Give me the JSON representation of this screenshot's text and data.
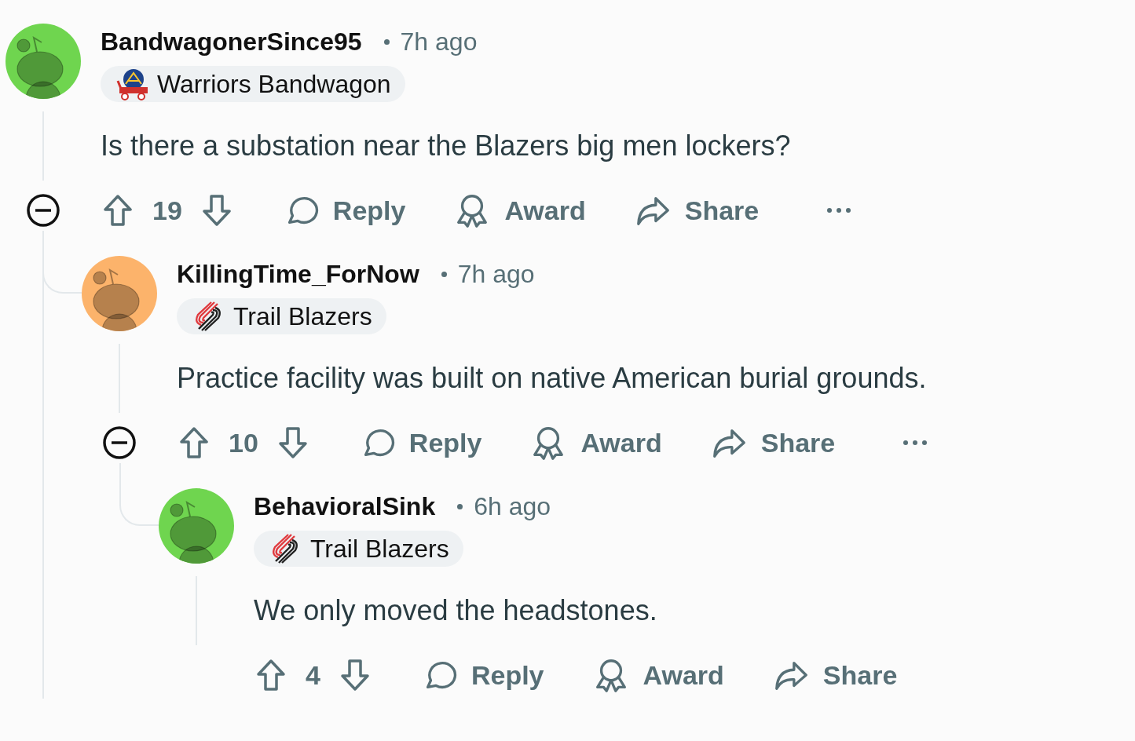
{
  "comments": [
    {
      "username": "BandwagonerSince95",
      "time": "7h ago",
      "color": "#6fd54f",
      "flair": {
        "kind": "warriors",
        "label": "Warriors Bandwagon"
      },
      "body": "Is there a substation near the Blazers big men lockers?",
      "score": "19",
      "actions": [
        {
          "kind": "reply",
          "label": "Reply"
        },
        {
          "kind": "award",
          "label": "Award"
        },
        {
          "kind": "share",
          "label": "Share"
        }
      ],
      "more": true,
      "children": [
        {
          "username": "KillingTime_ForNow",
          "time": "7h ago",
          "color": "#fcb36b",
          "flair": {
            "kind": "blazers",
            "label": "Trail Blazers"
          },
          "body": "Practice facility was built on native American burial grounds.",
          "score": "10",
          "actions": [
            {
              "kind": "reply",
              "label": "Reply"
            },
            {
              "kind": "award",
              "label": "Award"
            },
            {
              "kind": "share",
              "label": "Share"
            }
          ],
          "more": true,
          "children": [
            {
              "username": "BehavioralSink",
              "time": "6h ago",
              "color": "#6fd54f",
              "flair": {
                "kind": "blazers",
                "label": "Trail Blazers"
              },
              "body": "We only moved the headstones.",
              "score": "4",
              "actions": [
                {
                  "kind": "reply",
                  "label": "Reply"
                },
                {
                  "kind": "award",
                  "label": "Award"
                },
                {
                  "kind": "share",
                  "label": "Share"
                }
              ],
              "more": false
            }
          ]
        }
      ]
    }
  ]
}
